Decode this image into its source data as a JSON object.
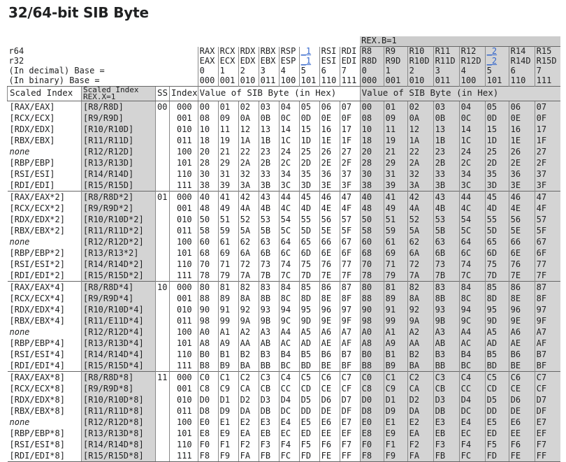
{
  "title": "32/64-bit SIB Byte",
  "rex_b_label": "REX.B=1",
  "header_labels": {
    "r64": "r64",
    "r32": "r32",
    "base_dec": "(In decimal) Base =",
    "base_bin": "(In binary) Base ="
  },
  "base_cols": {
    "r64": [
      "RAX",
      "RCX",
      "RDX",
      "RBX",
      "RSP",
      "_1",
      "RSI",
      "RDI",
      "R8",
      "R9",
      "R10",
      "R11",
      "R12",
      "_2",
      "R14",
      "R15"
    ],
    "r32": [
      "EAX",
      "ECX",
      "EDX",
      "EBX",
      "ESP",
      "_1",
      "ESI",
      "EDI",
      "R8D",
      "R9D",
      "R10D",
      "R11D",
      "R12D",
      "_2",
      "R14D",
      "R15D"
    ],
    "dec": [
      "0",
      "1",
      "2",
      "3",
      "4",
      "5",
      "6",
      "7",
      "0",
      "1",
      "2",
      "3",
      "4",
      "5",
      "6",
      "7"
    ],
    "bin": [
      "000",
      "001",
      "010",
      "011",
      "100",
      "101",
      "110",
      "111",
      "000",
      "001",
      "010",
      "011",
      "100",
      "101",
      "110",
      "111"
    ]
  },
  "column_headers": {
    "scaled_index": "Scaled Index",
    "scaled_index_rex": "Scaled Index REX.X=1",
    "ss": "SS",
    "index": "Index",
    "value1": "Value of SIB Byte (in Hex)",
    "value2": "Value of SIB Byte (in Hex)"
  },
  "groups": [
    {
      "ss": "00",
      "rows": [
        {
          "si": "[RAX/EAX]",
          "sx": "[R8/R8D]",
          "idx": "000"
        },
        {
          "si": "[RCX/ECX]",
          "sx": "[R9/R9D]",
          "idx": "001"
        },
        {
          "si": "[RDX/EDX]",
          "sx": "[R10/R10D]",
          "idx": "010"
        },
        {
          "si": "[RBX/EBX]",
          "sx": "[R11/R11D]",
          "idx": "011"
        },
        {
          "si": "none",
          "sx": "[R12/R12D]",
          "idx": "100"
        },
        {
          "si": "[RBP/EBP]",
          "sx": "[R13/R13D]",
          "idx": "101"
        },
        {
          "si": "[RSI/ESI]",
          "sx": "[R14/R14D]",
          "idx": "110"
        },
        {
          "si": "[RDI/EDI]",
          "sx": "[R15/R15D]",
          "idx": "111"
        }
      ]
    },
    {
      "ss": "01",
      "rows": [
        {
          "si": "[RAX/EAX*2]",
          "sx": "[R8/R8D*2]",
          "idx": "000"
        },
        {
          "si": "[RCX/ECX*2]",
          "sx": "[R9/R9D*2]",
          "idx": "001"
        },
        {
          "si": "[RDX/EDX*2]",
          "sx": "[R10/R10D*2]",
          "idx": "010"
        },
        {
          "si": "[RBX/EBX*2]",
          "sx": "[R11/R11D*2]",
          "idx": "011"
        },
        {
          "si": "none",
          "sx": "[R12/R12D*2]",
          "idx": "100"
        },
        {
          "si": "[RBP/EBP*2]",
          "sx": "[R13/R13*2]",
          "idx": "101"
        },
        {
          "si": "[RSI/ESI*2]",
          "sx": "[R14/R14D*2]",
          "idx": "110"
        },
        {
          "si": "[RDI/EDI*2]",
          "sx": "[R15/R15D*2]",
          "idx": "111"
        }
      ]
    },
    {
      "ss": "10",
      "rows": [
        {
          "si": "[RAX/EAX*4]",
          "sx": "[R8/R8D*4]",
          "idx": "000"
        },
        {
          "si": "[RCX/ECX*4]",
          "sx": "[R9/R9D*4]",
          "idx": "001"
        },
        {
          "si": "[RDX/EDX*4]",
          "sx": "[R10/R10D*4]",
          "idx": "010"
        },
        {
          "si": "[RBX/EBX*4]",
          "sx": "[R11/E11D*4]",
          "idx": "011"
        },
        {
          "si": "none",
          "sx": "[R12/R12D*4]",
          "idx": "100"
        },
        {
          "si": "[RBP/EBP*4]",
          "sx": "[R13/R13D*4]",
          "idx": "101"
        },
        {
          "si": "[RSI/ESI*4]",
          "sx": "[R14/R14D*4]",
          "idx": "110"
        },
        {
          "si": "[RDI/EDI*4]",
          "sx": "[R15/R15D*4]",
          "idx": "111"
        }
      ]
    },
    {
      "ss": "11",
      "rows": [
        {
          "si": "[RAX/EAX*8]",
          "sx": "[R8/R8D*8]",
          "idx": "000"
        },
        {
          "si": "[RCX/ECX*8]",
          "sx": "[R9/R9D*8]",
          "idx": "001"
        },
        {
          "si": "[RDX/EDX*8]",
          "sx": "[R10/R10D*8]",
          "idx": "010"
        },
        {
          "si": "[RBX/EBX*8]",
          "sx": "[R11/R11D*8]",
          "idx": "011"
        },
        {
          "si": "none",
          "sx": "[R12/R12D*8]",
          "idx": "100"
        },
        {
          "si": "[RBP/EBP*8]",
          "sx": "[R13/R13D*8]",
          "idx": "101"
        },
        {
          "si": "[RSI/ESI*8]",
          "sx": "[R14/R14D*8]",
          "idx": "110"
        },
        {
          "si": "[RDI/EDI*8]",
          "sx": "[R15/R15D*8]",
          "idx": "111"
        }
      ]
    }
  ],
  "hex_values": [
    [
      "00",
      "01",
      "02",
      "03",
      "04",
      "05",
      "06",
      "07"
    ],
    [
      "08",
      "09",
      "0A",
      "0B",
      "0C",
      "0D",
      "0E",
      "0F"
    ],
    [
      "10",
      "11",
      "12",
      "13",
      "14",
      "15",
      "16",
      "17"
    ],
    [
      "18",
      "19",
      "1A",
      "1B",
      "1C",
      "1D",
      "1E",
      "1F"
    ],
    [
      "20",
      "21",
      "22",
      "23",
      "24",
      "25",
      "26",
      "27"
    ],
    [
      "28",
      "29",
      "2A",
      "2B",
      "2C",
      "2D",
      "2E",
      "2F"
    ],
    [
      "30",
      "31",
      "32",
      "33",
      "34",
      "35",
      "36",
      "37"
    ],
    [
      "38",
      "39",
      "3A",
      "3B",
      "3C",
      "3D",
      "3E",
      "3F"
    ],
    [
      "40",
      "41",
      "42",
      "43",
      "44",
      "45",
      "46",
      "47"
    ],
    [
      "48",
      "49",
      "4A",
      "4B",
      "4C",
      "4D",
      "4E",
      "4F"
    ],
    [
      "50",
      "51",
      "52",
      "53",
      "54",
      "55",
      "56",
      "57"
    ],
    [
      "58",
      "59",
      "5A",
      "5B",
      "5C",
      "5D",
      "5E",
      "5F"
    ],
    [
      "60",
      "61",
      "62",
      "63",
      "64",
      "65",
      "66",
      "67"
    ],
    [
      "68",
      "69",
      "6A",
      "6B",
      "6C",
      "6D",
      "6E",
      "6F"
    ],
    [
      "70",
      "71",
      "72",
      "73",
      "74",
      "75",
      "76",
      "77"
    ],
    [
      "78",
      "79",
      "7A",
      "7B",
      "7C",
      "7D",
      "7E",
      "7F"
    ],
    [
      "80",
      "81",
      "82",
      "83",
      "84",
      "85",
      "86",
      "87"
    ],
    [
      "88",
      "89",
      "8A",
      "8B",
      "8C",
      "8D",
      "8E",
      "8F"
    ],
    [
      "90",
      "91",
      "92",
      "93",
      "94",
      "95",
      "96",
      "97"
    ],
    [
      "98",
      "99",
      "9A",
      "9B",
      "9C",
      "9D",
      "9E",
      "9F"
    ],
    [
      "A0",
      "A1",
      "A2",
      "A3",
      "A4",
      "A5",
      "A6",
      "A7"
    ],
    [
      "A8",
      "A9",
      "AA",
      "AB",
      "AC",
      "AD",
      "AE",
      "AF"
    ],
    [
      "B0",
      "B1",
      "B2",
      "B3",
      "B4",
      "B5",
      "B6",
      "B7"
    ],
    [
      "B8",
      "B9",
      "BA",
      "BB",
      "BC",
      "BD",
      "BE",
      "BF"
    ],
    [
      "C0",
      "C1",
      "C2",
      "C3",
      "C4",
      "C5",
      "C6",
      "C7"
    ],
    [
      "C8",
      "C9",
      "CA",
      "CB",
      "CC",
      "CD",
      "CE",
      "CF"
    ],
    [
      "D0",
      "D1",
      "D2",
      "D3",
      "D4",
      "D5",
      "D6",
      "D7"
    ],
    [
      "D8",
      "D9",
      "DA",
      "DB",
      "DC",
      "DD",
      "DE",
      "DF"
    ],
    [
      "E0",
      "E1",
      "E2",
      "E3",
      "E4",
      "E5",
      "E6",
      "E7"
    ],
    [
      "E8",
      "E9",
      "EA",
      "EB",
      "EC",
      "ED",
      "EE",
      "EF"
    ],
    [
      "F0",
      "F1",
      "F2",
      "F3",
      "F4",
      "F5",
      "F6",
      "F7"
    ],
    [
      "F8",
      "F9",
      "FA",
      "FB",
      "FC",
      "FD",
      "FE",
      "FF"
    ]
  ]
}
